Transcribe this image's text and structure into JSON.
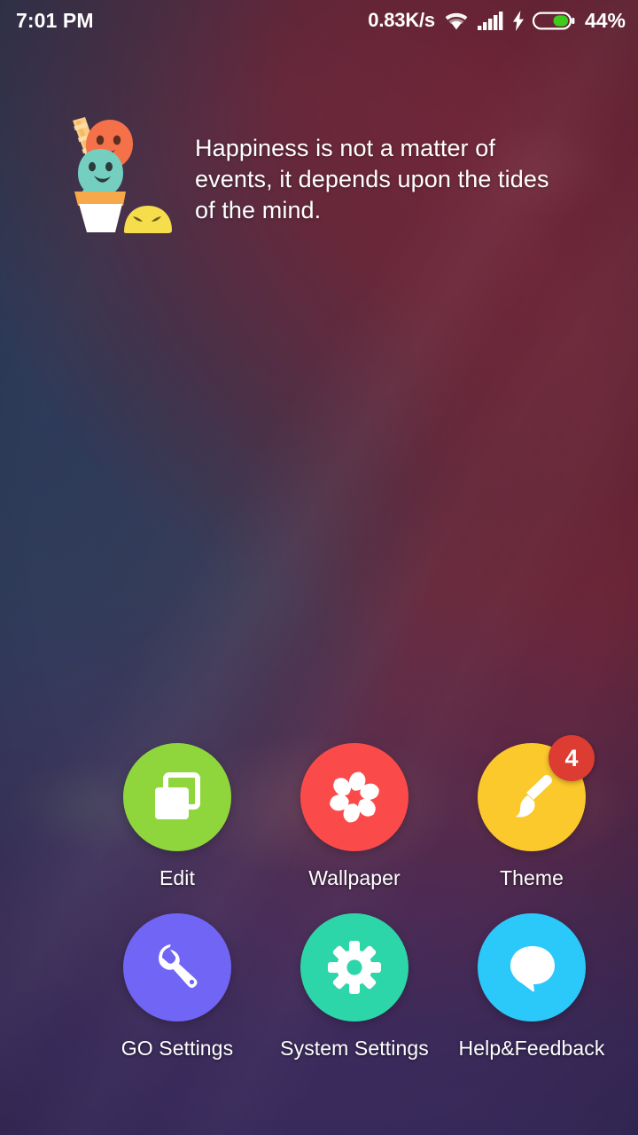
{
  "statusbar": {
    "clock": "7:01 PM",
    "network_speed": "0.83K/s",
    "battery_percent": "44%",
    "wifi_icon": "wifi-icon",
    "signal_icon": "signal-bars-icon",
    "charging_icon": "charging-bolt-icon",
    "battery_icon": "battery-icon",
    "battery_level": 44,
    "battery_fill_color": "#3ecb1e",
    "text_color": "#ffffff"
  },
  "quote_widget": {
    "text": "Happiness is not a matter of events, it depends upon the tides of the mind.",
    "illustration": "ice-cream-characters-illustration",
    "colors": {
      "scoop_top": "#f4714a",
      "scoop_bottom": "#74cfc0",
      "cone_rim": "#f7a84a",
      "cup": "#ffffff",
      "stick": "#f7c97a",
      "blob": "#f5dd4c"
    }
  },
  "app_grid": {
    "rows": [
      [
        {
          "label": "Edit",
          "icon": "copy-squares-icon",
          "color": "#8ed63c",
          "badge": null
        },
        {
          "label": "Wallpaper",
          "icon": "flower-petals-icon",
          "color": "#fb4a4a",
          "badge": null
        },
        {
          "label": "Theme",
          "icon": "paintbrush-icon",
          "color": "#fbc92b",
          "badge": "4"
        }
      ],
      [
        {
          "label": "GO Settings",
          "icon": "wrench-icon",
          "color": "#7165f5",
          "badge": null
        },
        {
          "label": "System Settings",
          "icon": "gear-icon",
          "color": "#2dd6a8",
          "badge": null
        },
        {
          "label": "Help&Feedback",
          "icon": "speech-bubble-icon",
          "color": "#2bc8fa",
          "badge": null
        }
      ]
    ],
    "badge_color": "#dc3c32",
    "icon_glyph_color": "#ffffff",
    "label_color": "#ffffff"
  },
  "wallpaper": {
    "top_right_color": "#6b2638",
    "mid_left_color": "#333e5a",
    "bottom_color": "#3d2d62"
  }
}
